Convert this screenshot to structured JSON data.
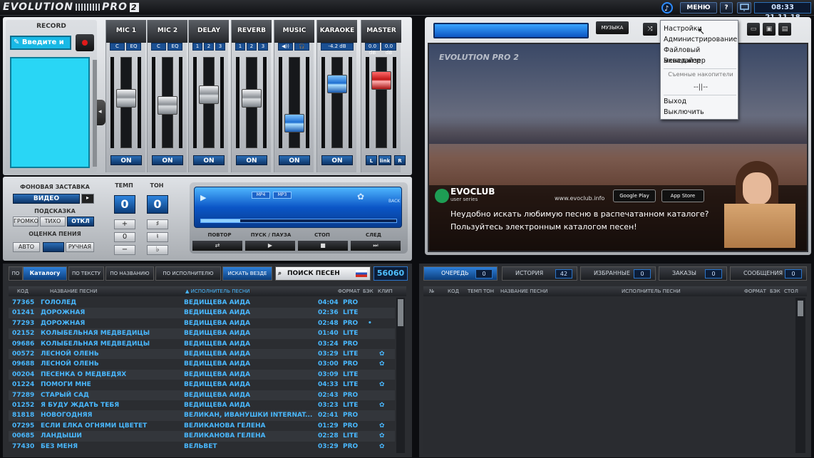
{
  "app": {
    "logo": "EVOLUTION",
    "logo_pro": "PRO",
    "logo_ver": "2"
  },
  "topbar": {
    "menu_label": "МЕНЮ",
    "help_label": "?",
    "clock": "08:33 21.11.18"
  },
  "record": {
    "title": "RECORD",
    "input_value": "Введите и"
  },
  "mixer": {
    "strips": [
      {
        "title": "MIC 1",
        "buttons": [
          "C",
          "EQ"
        ],
        "on": "ON",
        "fader": 0.55
      },
      {
        "title": "MIC 2",
        "buttons": [
          "C",
          "EQ"
        ],
        "on": "ON",
        "fader": 0.45
      },
      {
        "title": "DELAY",
        "buttons": [
          "1",
          "2",
          "3"
        ],
        "on": "ON",
        "fader": 0.6
      },
      {
        "title": "REVERB",
        "buttons": [
          "1",
          "2",
          "3"
        ],
        "on": "ON",
        "fader": 0.55
      },
      {
        "title": "MUSIC",
        "buttons": [
          "◀))",
          "🎧"
        ],
        "on": "ON",
        "fader": 0.2
      },
      {
        "title": "KARAOKE",
        "buttons": [
          "-4.2 dB"
        ],
        "on": "ON",
        "fader": 0.75
      },
      {
        "title": "MASTER",
        "buttons": [
          "0.0 dB",
          "0.0 dB"
        ],
        "on_left": "L",
        "on_mid": "link",
        "on_right": "R",
        "fader": 0.8
      }
    ]
  },
  "controls": {
    "bg_label": "ФОНОВАЯ ЗАСТАВКА",
    "bg_value": "ВИДЕО",
    "hint_label": "ПОДСКАЗКА",
    "hint_options": [
      "ГРОМКО",
      "ТИХО",
      "ОТКЛ"
    ],
    "score_label": "ОЦЕНКА ПЕНИЯ",
    "score_options": [
      "АВТО",
      "",
      "РУЧНАЯ"
    ],
    "tempo_label": "ТЕМП",
    "tempo_value": "0",
    "tone_label": "ТОН",
    "tone_value": "0",
    "tempo_buttons": [
      "+",
      "0",
      "−"
    ],
    "tone_buttons": [
      "♯",
      "♮",
      "♭"
    ]
  },
  "player": {
    "labels": [
      "ПОВТОР",
      "ПУСК / ПАУЗА",
      "СТОП",
      "СЛЕД"
    ],
    "buttons": [
      "⇄",
      "▶",
      "■",
      "⏭"
    ],
    "small_labels": [
      "MP4",
      "MP3"
    ],
    "back": "BACK",
    "progress": 0.2
  },
  "video": {
    "music_btn": "МУЗЫКА",
    "logo": "EVOLUTION PRO 2",
    "evoclub": "EVOCLUB",
    "evoclub_sub": "user series",
    "url": "www.evoclub.info",
    "google_play": "Google Play",
    "app_store": "App Store",
    "ad_line1": "Неудобно искать любимую песню в распечатанном каталоге?",
    "ad_line2": "Пользуйтесь электронным каталогом песен!"
  },
  "menu": {
    "items": [
      "Настройки",
      "Администрирование",
      "Файловый менеджер",
      "Эквалайзер"
    ],
    "removable_title": "Съемные накопители",
    "removable_value": "--||--",
    "exit": "Выход",
    "shutdown": "Выключить"
  },
  "filters": {
    "by": "ПО",
    "catalog": "Каталогу",
    "by_text": "ПО ТЕКСТУ",
    "by_name": "ПО НАЗВАНИЮ",
    "by_artist": "ПО ИСПОЛНИТЕЛЮ",
    "everywhere": "ИСКАТЬ ВЕЗДЕ",
    "search": "ПОИСК ПЕСЕН",
    "count": "56060"
  },
  "left_headers": {
    "code": "КОД",
    "name": "НАЗВАНИЕ ПЕСНИ",
    "artist": "ИСПОЛНИТЕЛЬ ПЕСНИ",
    "format": "ФОРМАТ",
    "bk": "БЭК",
    "clip": "КЛИП"
  },
  "songs": [
    {
      "code": "77365",
      "name": "ГОЛОЛЕД",
      "artist": "ВЕДИЩЕВА АИДА",
      "time": "04:04",
      "fmt": "PRO",
      "bk": "",
      "clip": ""
    },
    {
      "code": "01241",
      "name": "ДОРОЖНАЯ",
      "artist": "ВЕДИЩЕВА АИДА",
      "time": "02:36",
      "fmt": "LITE",
      "bk": "",
      "clip": ""
    },
    {
      "code": "77293",
      "name": "ДОРОЖНАЯ",
      "artist": "ВЕДИЩЕВА АИДА",
      "time": "02:48",
      "fmt": "PRO",
      "bk": "•",
      "clip": ""
    },
    {
      "code": "02152",
      "name": "КОЛЫБЕЛЬНАЯ МЕДВЕДИЦЫ",
      "artist": "ВЕДИЩЕВА АИДА",
      "time": "01:40",
      "fmt": "LITE",
      "bk": "",
      "clip": ""
    },
    {
      "code": "09686",
      "name": "КОЛЫБЕЛЬНАЯ МЕДВЕДИЦЫ",
      "artist": "ВЕДИЩЕВА АИДА",
      "time": "03:24",
      "fmt": "PRO",
      "bk": "",
      "clip": ""
    },
    {
      "code": "00572",
      "name": "ЛЕСНОЙ ОЛЕНЬ",
      "artist": "ВЕДИЩЕВА АИДА",
      "time": "03:29",
      "fmt": "LITE",
      "bk": "",
      "clip": "✿"
    },
    {
      "code": "09688",
      "name": "ЛЕСНОЙ ОЛЕНЬ",
      "artist": "ВЕДИЩЕВА АИДА",
      "time": "03:00",
      "fmt": "PRO",
      "bk": "",
      "clip": "✿"
    },
    {
      "code": "00204",
      "name": "ПЕСЕНКА О МЕДВЕДЯХ",
      "artist": "ВЕДИЩЕВА АИДА",
      "time": "03:09",
      "fmt": "LITE",
      "bk": "",
      "clip": ""
    },
    {
      "code": "01224",
      "name": "ПОМОГИ МНЕ",
      "artist": "ВЕДИЩЕВА АИДА",
      "time": "04:33",
      "fmt": "LITE",
      "bk": "",
      "clip": "✿"
    },
    {
      "code": "77289",
      "name": "СТАРЫЙ САД",
      "artist": "ВЕДИЩЕВА АИДА",
      "time": "02:43",
      "fmt": "PRO",
      "bk": "",
      "clip": ""
    },
    {
      "code": "01252",
      "name": "Я БУДУ ЖДАТЬ ТЕБЯ",
      "artist": "ВЕДИЩЕВА АИДА",
      "time": "03:23",
      "fmt": "LITE",
      "bk": "",
      "clip": "✿"
    },
    {
      "code": "81818",
      "name": "НОВОГОДНЯЯ",
      "artist": "ВЕЛИКАН, ИВАНУШКИ INTERNAT...",
      "time": "02:41",
      "fmt": "PRO",
      "bk": "",
      "clip": ""
    },
    {
      "code": "07295",
      "name": "ЕСЛИ ЕЛКА ОГНЯМИ ЦВЕТЕТ",
      "artist": "ВЕЛИКАНОВА ГЕЛЕНА",
      "time": "01:29",
      "fmt": "PRO",
      "bk": "",
      "clip": "✿"
    },
    {
      "code": "00685",
      "name": "ЛАНДЫШИ",
      "artist": "ВЕЛИКАНОВА ГЕЛЕНА",
      "time": "02:28",
      "fmt": "LITE",
      "bk": "",
      "clip": "✿"
    },
    {
      "code": "77430",
      "name": "БЕЗ МЕНЯ",
      "artist": "ВЕЛЬВЕТ",
      "time": "03:29",
      "fmt": "PRO",
      "bk": "",
      "clip": "✿"
    }
  ],
  "right_tabs": [
    {
      "label": "ОЧЕРЕДЬ",
      "count": "0"
    },
    {
      "label": "ИСТОРИЯ",
      "count": "42"
    },
    {
      "label": "ИЗБРАННЫЕ",
      "count": "0"
    },
    {
      "label": "ЗАКАЗЫ",
      "count": "0"
    },
    {
      "label": "СООБЩЕНИЯ",
      "count": "0"
    }
  ],
  "right_headers": {
    "num": "№",
    "code": "КОД",
    "tempo": "ТЕМП",
    "tone": "ТОН",
    "name": "НАЗВАНИЕ ПЕСНИ",
    "artist": "ИСПОЛНИТЕЛЬ ПЕСНИ",
    "format": "ФОРМАТ",
    "bk": "БЭК",
    "table": "СТОЛ"
  }
}
